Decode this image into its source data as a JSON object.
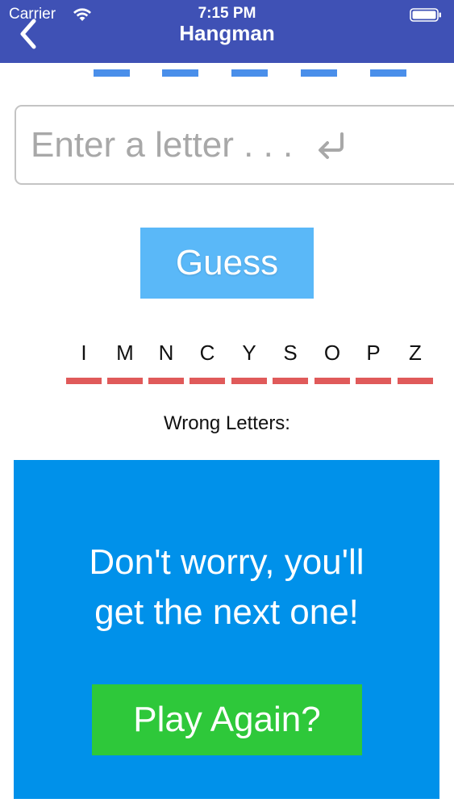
{
  "status_bar": {
    "carrier": "Carrier",
    "time": "7:15 PM"
  },
  "nav": {
    "title": "Hangman",
    "back_icon": "chevron-left-icon"
  },
  "word": {
    "blank_count": 5,
    "blank_color": "#4a8fea"
  },
  "input": {
    "value": "",
    "placeholder": "Enter a letter . . .",
    "return_icon": "return-key-icon"
  },
  "guess_button": {
    "label": "Guess",
    "color": "#5ab8f8"
  },
  "guessed_letters": [
    "I",
    "M",
    "N",
    "C",
    "Y",
    "S",
    "O",
    "P",
    "Z"
  ],
  "wrong_letters_label": "Wrong Letters:",
  "result": {
    "message_line1": "Don't worry, you'll",
    "message_line2": "get the next one!",
    "panel_color": "#0091ea",
    "play_again_label": "Play Again?",
    "play_again_color": "#2ec83a"
  },
  "colors": {
    "nav_bar": "#3f51b5",
    "underline_red": "#e05a5a"
  }
}
